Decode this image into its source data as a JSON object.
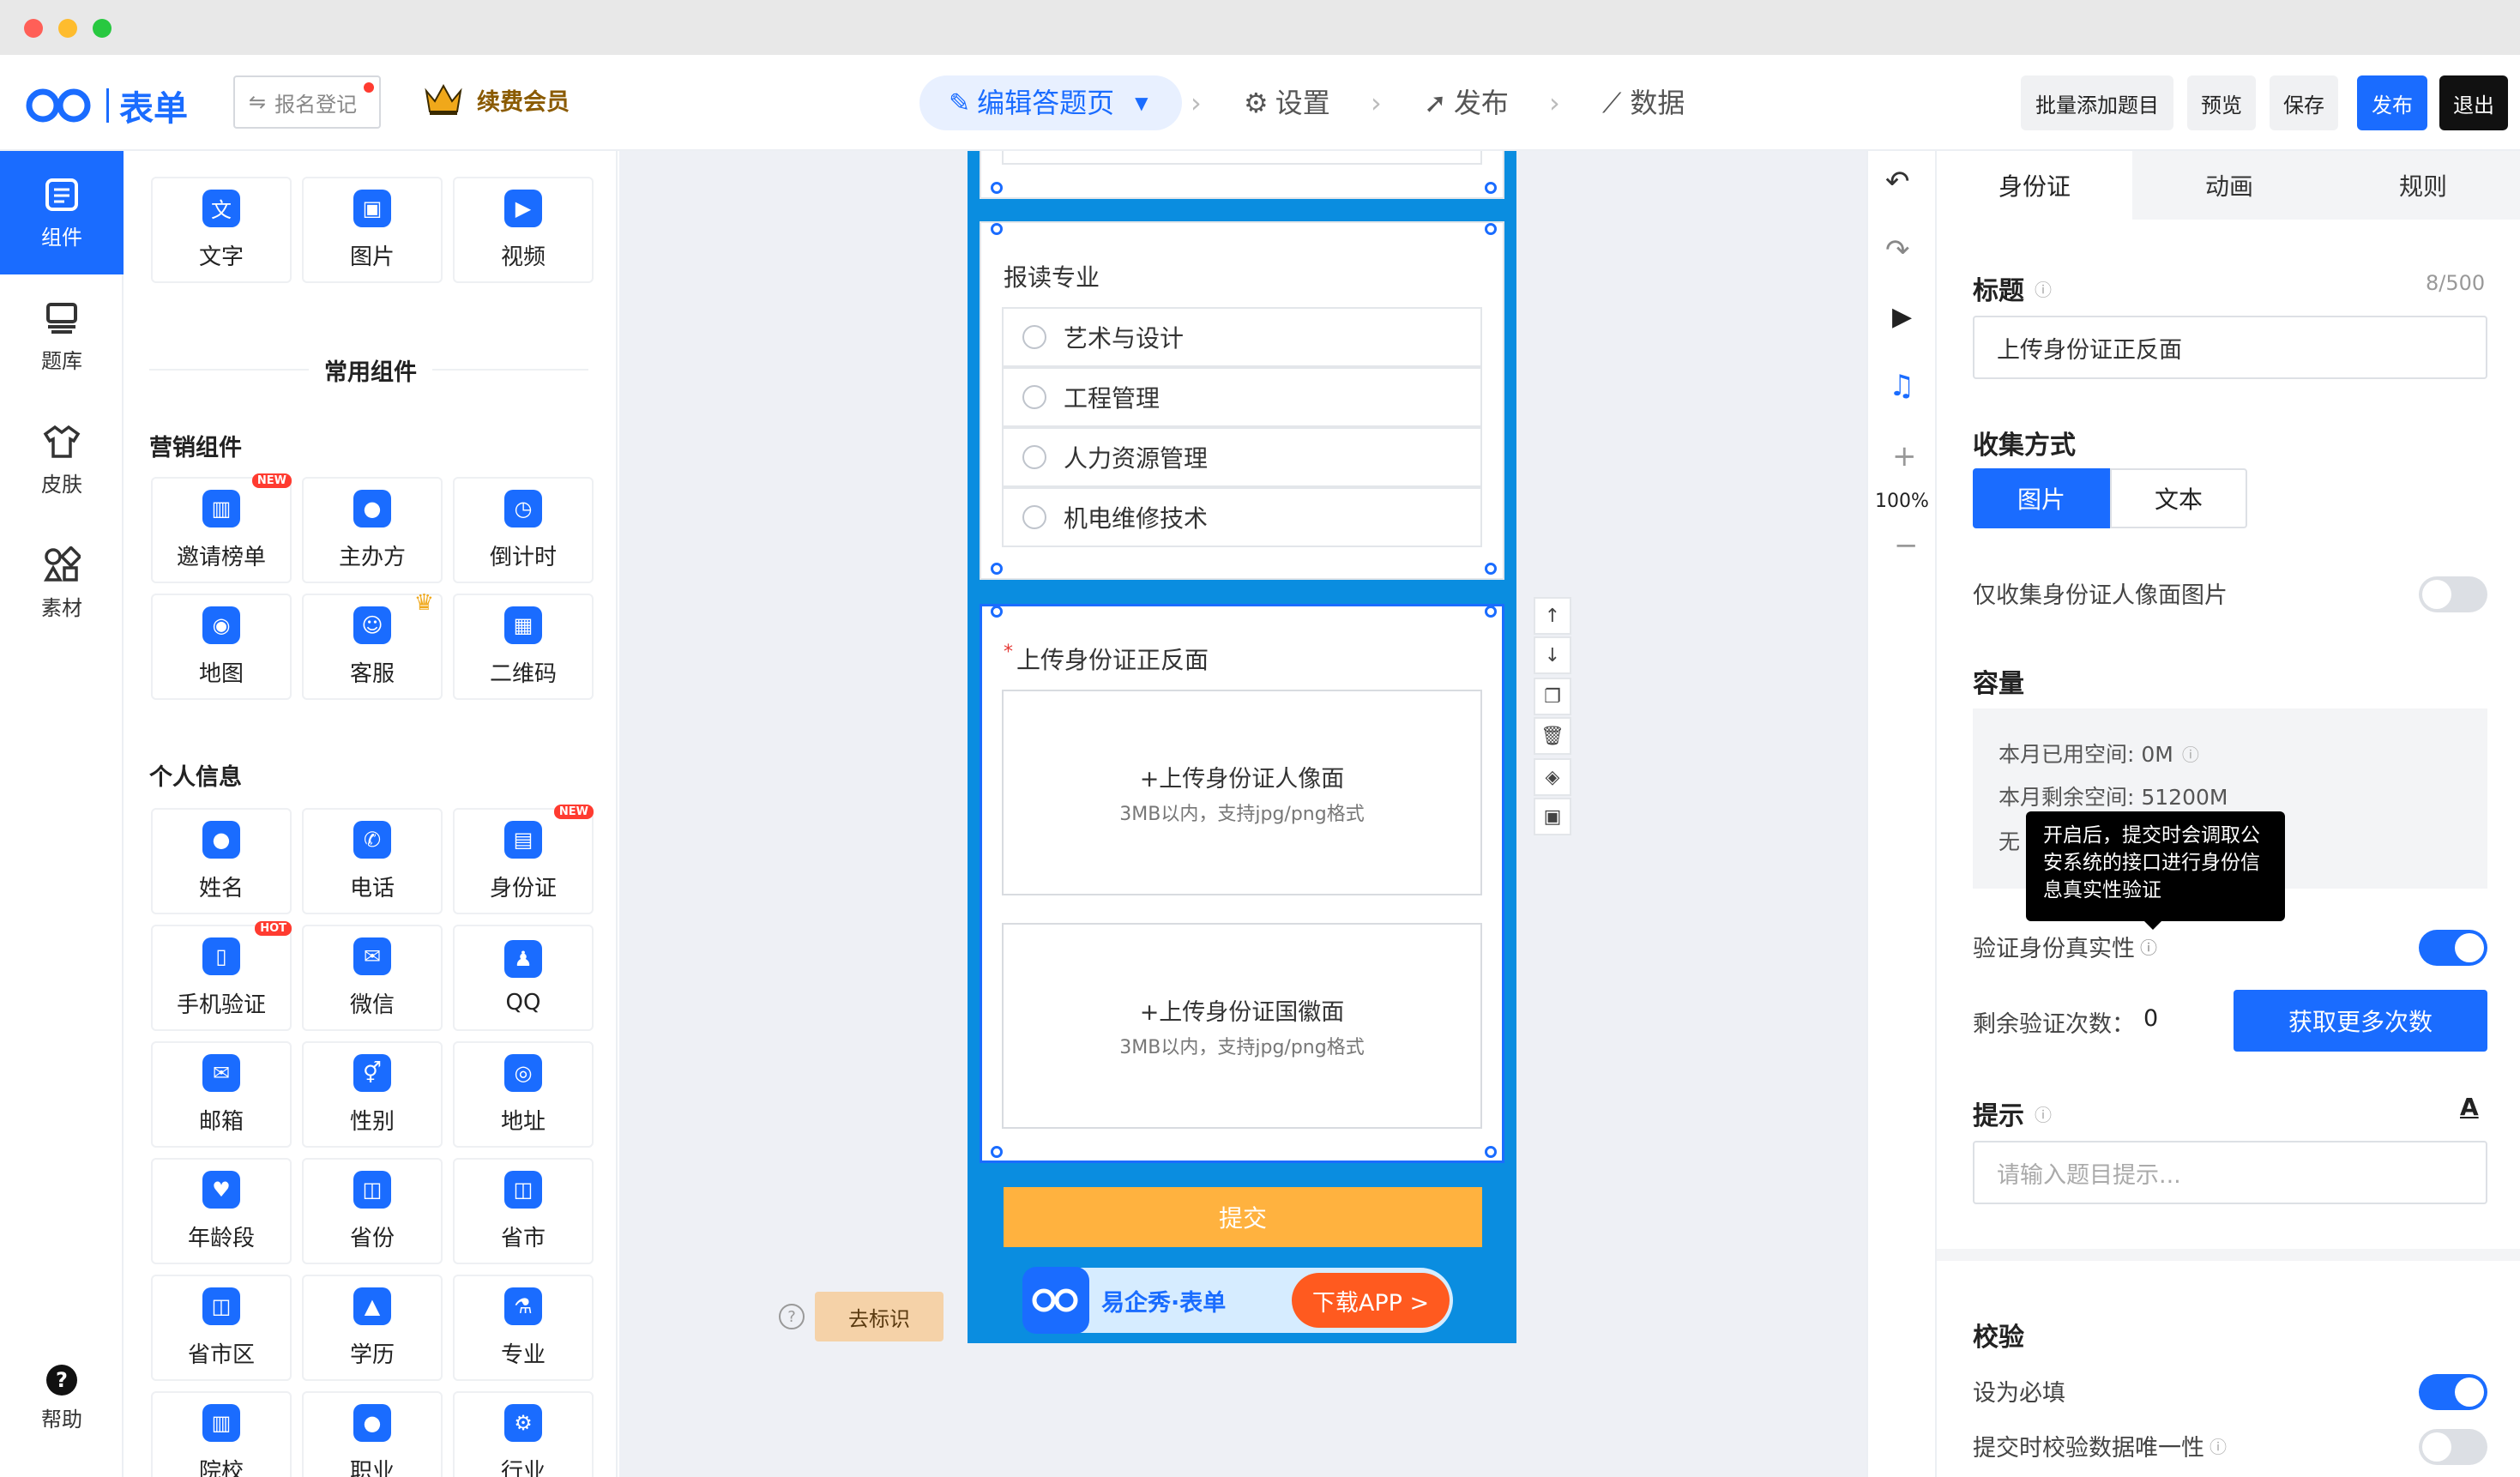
{
  "brand": {
    "logo_text": "表单"
  },
  "header": {
    "form_name_placeholder": "报名登记",
    "vip_label": "续费会员",
    "steps": [
      {
        "label": "编辑答题页"
      },
      {
        "label": "设置"
      },
      {
        "label": "发布"
      },
      {
        "label": "数据"
      }
    ],
    "actions": {
      "batch_add": "批量添加题目",
      "preview": "预览",
      "save": "保存",
      "publish": "发布",
      "exit": "退出"
    }
  },
  "rail": {
    "items": [
      {
        "label": "组件",
        "icon": "components-icon"
      },
      {
        "label": "题库",
        "icon": "question-bank-icon"
      },
      {
        "label": "皮肤",
        "icon": "skin-icon"
      },
      {
        "label": "素材",
        "icon": "assets-icon"
      }
    ],
    "help": "帮助"
  },
  "components": {
    "basic": [
      {
        "label": "文字",
        "icon": "text-icon",
        "glyph": "文"
      },
      {
        "label": "图片",
        "icon": "image-icon",
        "glyph": "▣"
      },
      {
        "label": "视频",
        "icon": "video-icon",
        "glyph": "▶"
      }
    ],
    "common_title": "常用组件",
    "marketing_title": "营销组件",
    "marketing": [
      {
        "label": "邀请榜单",
        "icon": "leaderboard-icon",
        "glyph": "▥",
        "badge": "NEW"
      },
      {
        "label": "主办方",
        "icon": "host-icon",
        "glyph": "●"
      },
      {
        "label": "倒计时",
        "icon": "countdown-icon",
        "glyph": "◷"
      },
      {
        "label": "地图",
        "icon": "map-icon",
        "glyph": "◉"
      },
      {
        "label": "客服",
        "icon": "customer-service-icon",
        "glyph": "☺",
        "crown": true
      },
      {
        "label": "二维码",
        "icon": "qrcode-icon",
        "glyph": "▦"
      }
    ],
    "personal_title": "个人信息",
    "personal": [
      {
        "label": "姓名",
        "icon": "name-icon",
        "glyph": "●"
      },
      {
        "label": "电话",
        "icon": "phone-icon",
        "glyph": "✆"
      },
      {
        "label": "身份证",
        "icon": "idcard-icon",
        "glyph": "▤",
        "badge": "NEW"
      },
      {
        "label": "手机验证",
        "icon": "mobile-verify-icon",
        "glyph": "▯",
        "badge": "HOT"
      },
      {
        "label": "微信",
        "icon": "wechat-icon",
        "glyph": "✉"
      },
      {
        "label": "QQ",
        "icon": "qq-icon",
        "glyph": "♟"
      },
      {
        "label": "邮箱",
        "icon": "email-icon",
        "glyph": "✉"
      },
      {
        "label": "性别",
        "icon": "gender-icon",
        "glyph": "⚥"
      },
      {
        "label": "地址",
        "icon": "address-icon",
        "glyph": "◎"
      },
      {
        "label": "年龄段",
        "icon": "age-icon",
        "glyph": "♥"
      },
      {
        "label": "省份",
        "icon": "province-icon",
        "glyph": "◫"
      },
      {
        "label": "省市",
        "icon": "city-icon",
        "glyph": "◫"
      },
      {
        "label": "省市区",
        "icon": "district-icon",
        "glyph": "◫"
      },
      {
        "label": "学历",
        "icon": "education-icon",
        "glyph": "▲"
      },
      {
        "label": "专业",
        "icon": "major-icon",
        "glyph": "⚗"
      },
      {
        "label": "院校",
        "icon": "school-icon",
        "glyph": "▥"
      },
      {
        "label": "职业",
        "icon": "occupation-icon",
        "glyph": "●"
      },
      {
        "label": "行业",
        "icon": "industry-icon",
        "glyph": "⚙"
      }
    ]
  },
  "form": {
    "major_question": {
      "title": "报读专业",
      "options": [
        "艺术与设计",
        "工程管理",
        "人力资源管理",
        "机电维修技术"
      ]
    },
    "id_question": {
      "required_mark": "*",
      "title": "上传身份证正反面",
      "front": {
        "label": "+上传身份证人像面",
        "hint": "3MB以内，支持jpg/png格式"
      },
      "back": {
        "label": "+上传身份证国徽面",
        "hint": "3MB以内，支持jpg/png格式"
      }
    },
    "submit": "提交",
    "app_banner": {
      "brand": "易企秀·表单",
      "button": "下载APP >"
    },
    "watermark_button": "去标识"
  },
  "sidetools": {
    "zoom": "100%"
  },
  "props": {
    "tabs": [
      "身份证",
      "动画",
      "规则"
    ],
    "title_label": "标题",
    "title_count": "8/500",
    "title_value": "上传身份证正反面",
    "collect_label": "收集方式",
    "collect_options": [
      "图片",
      "文本"
    ],
    "portrait_only_label": "仅收集身份证人像面图片",
    "portrait_only_on": false,
    "capacity_label": "容量",
    "capacity_used": "本月已用空间: 0M",
    "capacity_left": "本月剩余空间: 51200M",
    "capacity_third": "无",
    "tooltip": "开启后，提交时会调取公安系统的接口进行身份信息真实性验证",
    "verify_label": "验证身份真实性",
    "verify_on": true,
    "remaining_label": "剩余验证次数：",
    "remaining_value": "0",
    "get_more": "获取更多次数",
    "hint_label": "提示",
    "hint_placeholder": "请输入题目提示...",
    "validate_label": "校验",
    "required_label": "设为必填",
    "required_on": true,
    "unique_label": "提交时校验数据唯一性",
    "unique_on": false
  },
  "colors": {
    "accent": "#1a6cff",
    "phone_bg": "#0a8de0",
    "submit": "#ffb23f",
    "dark": "#111111"
  }
}
